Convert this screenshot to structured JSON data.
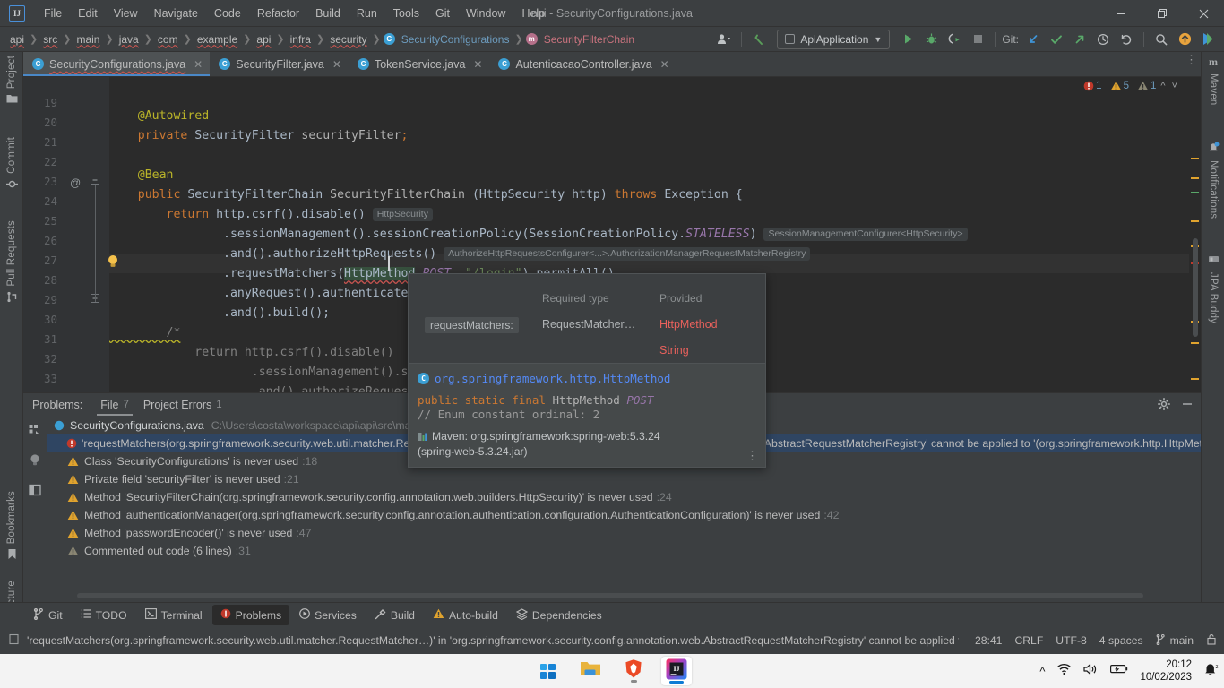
{
  "window": {
    "title": "api - SecurityConfigurations.java",
    "logo": "intellij-idea-logo",
    "minimize": "—",
    "maximize": "❐",
    "close": "✕"
  },
  "menu": [
    "File",
    "Edit",
    "View",
    "Navigate",
    "Code",
    "Refactor",
    "Build",
    "Run",
    "Tools",
    "Git",
    "Window",
    "Help"
  ],
  "breadcrumbs": [
    {
      "label": "api",
      "kind": "plain"
    },
    {
      "label": "src",
      "kind": "plain"
    },
    {
      "label": "main",
      "kind": "plain"
    },
    {
      "label": "java",
      "kind": "plain"
    },
    {
      "label": "com",
      "kind": "plain"
    },
    {
      "label": "example",
      "kind": "plain"
    },
    {
      "label": "api",
      "kind": "plain"
    },
    {
      "label": "infra",
      "kind": "plain"
    },
    {
      "label": "security",
      "kind": "plain"
    },
    {
      "label": "SecurityConfigurations",
      "kind": "class"
    },
    {
      "label": "SecurityFilterChain",
      "kind": "method"
    }
  ],
  "toolbar": {
    "run_config": "ApiApplication",
    "git_label": "Git:",
    "buttons": [
      "user-settings",
      "back-arrow",
      "run",
      "debug",
      "run-with-coverage",
      "stop",
      "git-update",
      "git-commit",
      "git-push",
      "history",
      "rollback",
      "search",
      "updates",
      "ide-features"
    ]
  },
  "tabs": [
    {
      "label": "SecurityConfigurations.java",
      "active": true,
      "error": true
    },
    {
      "label": "SecurityFilter.java",
      "active": false,
      "error": false
    },
    {
      "label": "TokenService.java",
      "active": false,
      "error": false
    },
    {
      "label": "AutenticacaoController.java",
      "active": false,
      "error": false
    }
  ],
  "editor": {
    "first_line": 19,
    "lines": [
      {
        "n": 19,
        "text": ""
      },
      {
        "n": 20,
        "text": "    @Autowired"
      },
      {
        "n": 21,
        "text": "    private SecurityFilter securityFilter;"
      },
      {
        "n": 22,
        "text": ""
      },
      {
        "n": 23,
        "text": "    @Bean"
      },
      {
        "n": 24,
        "text": "    public SecurityFilterChain SecurityFilterChain (HttpSecurity http) throws Exception {"
      },
      {
        "n": 25,
        "text": "        return http.csrf().disable()"
      },
      {
        "n": 26,
        "text": "                .sessionManagement().sessionCreationPolicy(SessionCreationPolicy.STATELESS)"
      },
      {
        "n": 27,
        "text": "                .and().authorizeHttpRequests()"
      },
      {
        "n": 28,
        "text": "                .requestMatchers(HttpMethod.POST, \"/login\").permitAll()"
      },
      {
        "n": 29,
        "text": "                .anyRequest().authenticated()"
      },
      {
        "n": 30,
        "text": "                .and().build();"
      },
      {
        "n": 31,
        "text": "        /*"
      },
      {
        "n": 32,
        "text": "        return http.csrf().disable()"
      },
      {
        "n": 33,
        "text": "                .sessionManagement().sessi"
      },
      {
        "n": 34,
        "text": "                .and().authorizeRequests()"
      }
    ],
    "inlay_hints": [
      "HttpSecurity",
      "SessionManagementConfigurer<HttpSecurity>",
      "AuthorizeHttpRequestsConfigurer<...>.AuthorizationManagerRequestMatcherRegistry"
    ],
    "caret_line": 28,
    "gutter_bulb": "intention-bulb",
    "gutter_bean_marker": "@"
  },
  "inspections": {
    "error_count": "1",
    "warning_count": "5",
    "weak_warning_count": "1"
  },
  "popup": {
    "col_required": "Required type",
    "col_provided": "Provided",
    "param_chip": "requestMatchers:",
    "required_value": "RequestMatcher…",
    "provided_1": "HttpMethod",
    "provided_2": "String",
    "fqn": "org.springframework.http.HttpMethod",
    "signature_keywords": "public static final",
    "signature_type": "HttpMethod",
    "signature_name": "POST",
    "comment": "// Enum constant ordinal: 2",
    "maven_line1": "Maven: org.springframework:spring-web:5.3.24",
    "maven_line2": "(spring-web-5.3.24.jar)",
    "more_actions": "⋮"
  },
  "problems": {
    "title": "Problems:",
    "tabs": [
      {
        "label": "File",
        "count": "7",
        "active": true
      },
      {
        "label": "Project Errors",
        "count": "1",
        "active": false
      }
    ],
    "file_row": {
      "name": "SecurityConfigurations.java",
      "path": "C:\\Users\\costa\\workspace\\api\\api\\src\\main\\ja"
    },
    "rows": [
      {
        "severity": "error",
        "text": "'requestMatchers(org.springframework.security.web.util.matcher.RequestMatcher…)' in 'org.springframework.security.config.annotation.web.AbstractRequestMatcherRegistry' cannot be applied to '(org.springframework.http.HttpMethod, ja",
        "line": "",
        "selected": true
      },
      {
        "severity": "warning",
        "text": "Class 'SecurityConfigurations' is never used",
        "line": ":18",
        "selected": false
      },
      {
        "severity": "warning",
        "text": "Private field 'securityFilter' is never used",
        "line": ":21",
        "selected": false
      },
      {
        "severity": "warning",
        "text": "Method 'SecurityFilterChain(org.springframework.security.config.annotation.web.builders.HttpSecurity)' is never used",
        "line": ":24",
        "selected": false
      },
      {
        "severity": "warning",
        "text": "Method 'authenticationManager(org.springframework.security.config.annotation.authentication.configuration.AuthenticationConfiguration)' is never used",
        "line": ":42",
        "selected": false
      },
      {
        "severity": "warning",
        "text": "Method 'passwordEncoder()' is never used",
        "line": ":47",
        "selected": false
      },
      {
        "severity": "weak",
        "text": "Commented out code (6 lines)",
        "line": ":31",
        "selected": false
      }
    ],
    "header_icons": [
      "settings-gear",
      "hide-panel"
    ]
  },
  "stripes": {
    "left": [
      "Project",
      "Commit",
      "Pull Requests",
      "Bookmarks",
      "Structure"
    ],
    "right": [
      "Maven",
      "Notifications",
      "JPA Buddy"
    ]
  },
  "toolwindows": [
    {
      "label": "Git",
      "icon": "git-branch-icon",
      "active": false
    },
    {
      "label": "TODO",
      "icon": "todo-list-icon",
      "active": false
    },
    {
      "label": "Terminal",
      "icon": "terminal-icon",
      "active": false
    },
    {
      "label": "Problems",
      "icon": "error-icon",
      "active": true
    },
    {
      "label": "Services",
      "icon": "services-icon",
      "active": false
    },
    {
      "label": "Build",
      "icon": "hammer-icon",
      "active": false
    },
    {
      "label": "Auto-build",
      "icon": "warning-triangle-icon",
      "active": false
    },
    {
      "label": "Dependencies",
      "icon": "layers-icon",
      "active": false
    }
  ],
  "statusbar": {
    "message": "'requestMatchers(org.springframework.security.web.util.matcher.RequestMatcher…)' in 'org.springframework.security.config.annotation.web.AbstractRequestMatcherRegistry' cannot be applied to '(…",
    "caret_position": "28:41",
    "line_separator": "CRLF",
    "encoding": "UTF-8",
    "indent": "4 spaces",
    "branch": "main",
    "lock_icon": "read-only-lock-icon"
  },
  "taskbar": {
    "items": [
      {
        "name": "start-button",
        "icon": "windows-logo"
      },
      {
        "name": "file-explorer",
        "icon": "folder-icon"
      },
      {
        "name": "brave-browser",
        "icon": "brave-lion-icon"
      },
      {
        "name": "intellij-idea",
        "icon": "intellij-icon",
        "active": true
      }
    ],
    "tray": {
      "overflow": "⌃",
      "wifi": "wifi-icon",
      "volume": "speaker-icon",
      "battery": "battery-charging-icon",
      "time": "20:12",
      "date": "10/02/2023",
      "notifications": "notifications-bell-icon"
    }
  },
  "colors": {
    "accent": "#4a88c7",
    "error": "#db5c5c",
    "warning": "#e0a32e",
    "editor_bg": "#2b2b2b",
    "panel_bg": "#3c3f41"
  }
}
